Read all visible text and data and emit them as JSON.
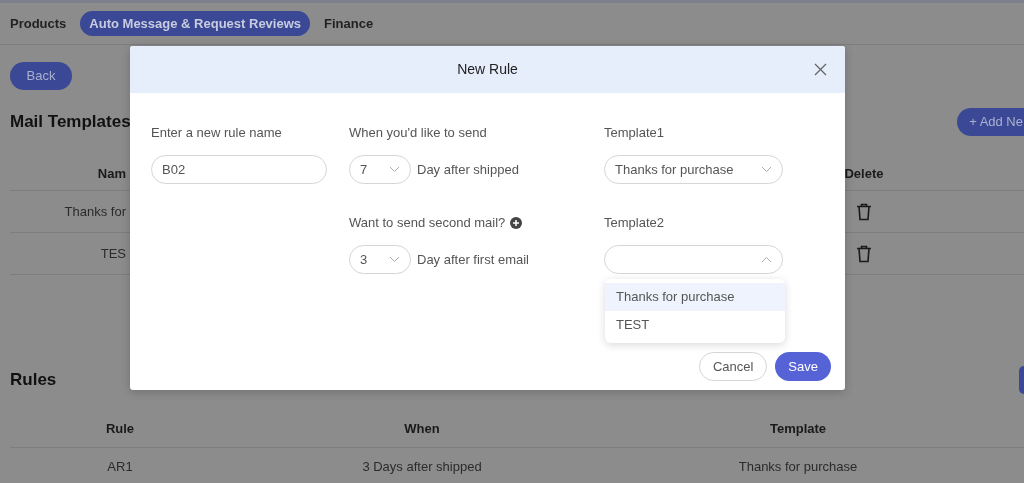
{
  "top_tabs": [
    {
      "label": "Products",
      "selected": false
    },
    {
      "label": "Auto Message & Request Reviews",
      "selected": true
    },
    {
      "label": "Finance",
      "selected": false
    }
  ],
  "back_button": "Back",
  "mail_templates": {
    "title": "Mail Templates",
    "add_button": "+ Add Ne",
    "columns": [
      "Nam",
      "Delete"
    ],
    "rows": [
      {
        "name": "Thanks for"
      },
      {
        "name": "TES"
      }
    ]
  },
  "rules": {
    "title": "Rules",
    "columns": [
      "Rule",
      "When",
      "Template"
    ],
    "rows": [
      {
        "rule": "AR1",
        "when": "3 Days after shipped",
        "template": "Thanks for purchase"
      }
    ]
  },
  "modal": {
    "title": "New Rule",
    "rule_name": {
      "label": "Enter a new rule name",
      "value": "B02"
    },
    "send": {
      "label": "When you'd like to send",
      "day": "7",
      "suffix": "Day after shipped"
    },
    "template1": {
      "label": "Template1",
      "value": "Thanks for purchase",
      "expanded": false
    },
    "second": {
      "label": "Want to send second mail?",
      "day": "3",
      "suffix": "Day after first email"
    },
    "template2": {
      "label": "Template2",
      "expanded": true,
      "options": [
        {
          "label": "Thanks for purchase",
          "selected": true
        },
        {
          "label": "TEST",
          "selected": false
        }
      ]
    },
    "cancel": "Cancel",
    "save": "Save"
  }
}
